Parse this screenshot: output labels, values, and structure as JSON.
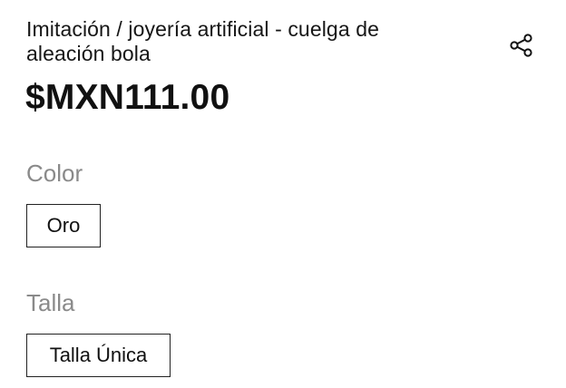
{
  "product": {
    "title": "Imitación / joyería artificial - cuelga de aleación bola",
    "price": "$MXN111.00"
  },
  "share": {
    "icon": "share-icon"
  },
  "options": {
    "color": {
      "label": "Color",
      "selected": "Oro"
    },
    "size": {
      "label": "Talla",
      "selected": "Talla Única"
    }
  }
}
